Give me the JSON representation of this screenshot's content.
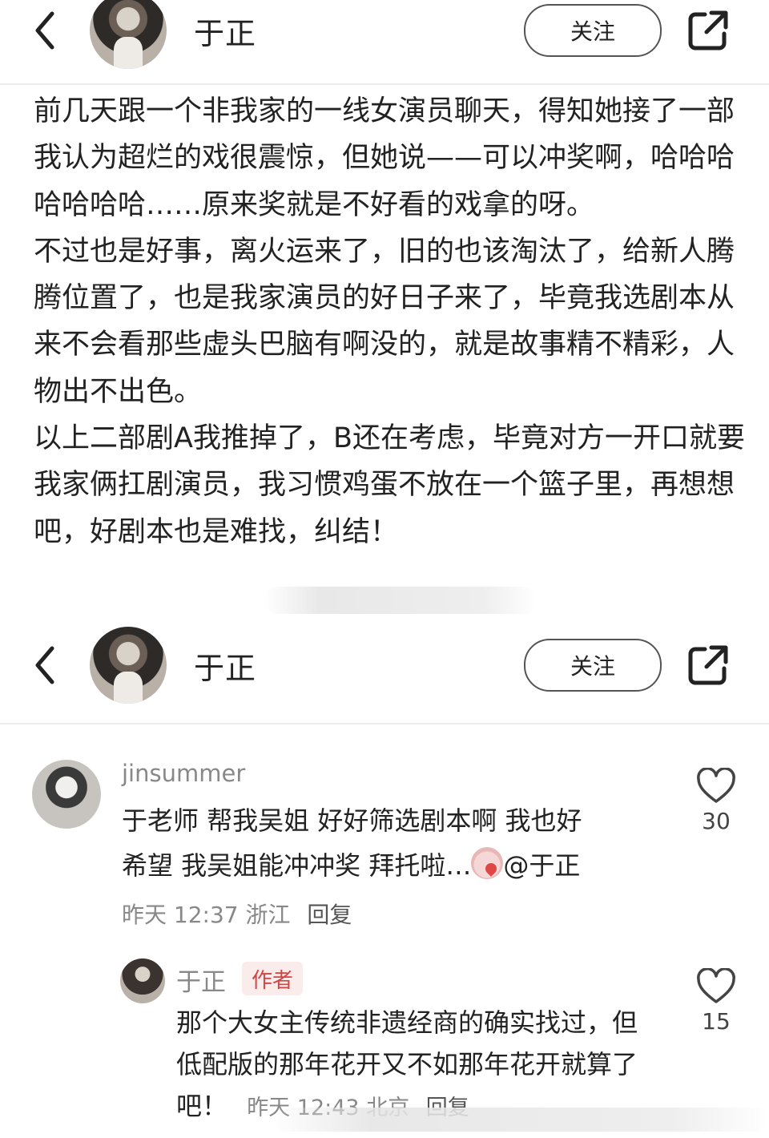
{
  "top_header": {
    "author_name": "于正",
    "follow_label": "关注"
  },
  "post": {
    "paragraphs": [
      "前几天跟一个非我家的一线女演员聊天，得知她接了一部我认为超烂的戏很震惊，但她说——可以冲奖啊，哈哈哈哈哈哈哈……原来奖就是不好看的戏拿的呀。",
      "不过也是好事，离火运来了，旧的也该淘汰了，给新人腾腾位置了，也是我家演员的好日子来了，毕竟我选剧本从来不会看那些虚头巴脑有啊没的，就是故事精不精彩，人物出不出色。",
      "以上二部剧A我推掉了，B还在考虑，毕竟对方一开口就要我家俩扛剧演员，我习惯鸡蛋不放在一个篮子里，再想想吧，好剧本也是难找，纠结！"
    ]
  },
  "second_header": {
    "author_name": "于正",
    "follow_label": "关注"
  },
  "comments": [
    {
      "username": "jinsummer",
      "text_line1": "于老师 帮我吴姐 好好筛选剧本啊 我也好",
      "text_line2_a": "希望 我吴姐能冲冲奖 拜托啦…",
      "text_line2_b": "@于正",
      "time": "昨天 12:37",
      "location": "浙江",
      "reply_label": "回复",
      "likes": "30"
    },
    {
      "username": "于正",
      "tag": "作者",
      "text": "那个大女主传统非遗经商的确实找过，但低配版的那年花开又不如那年花开就算了吧！",
      "time": "昨天 12:43",
      "location": "北京",
      "reply_label": "回复",
      "likes": "15"
    }
  ],
  "icons": {
    "back": "chevron-left-icon",
    "share": "share-external-icon",
    "like": "heart-outline-icon"
  },
  "colors": {
    "author_tag_bg": "#fbecec",
    "author_tag_text": "#d14545"
  }
}
